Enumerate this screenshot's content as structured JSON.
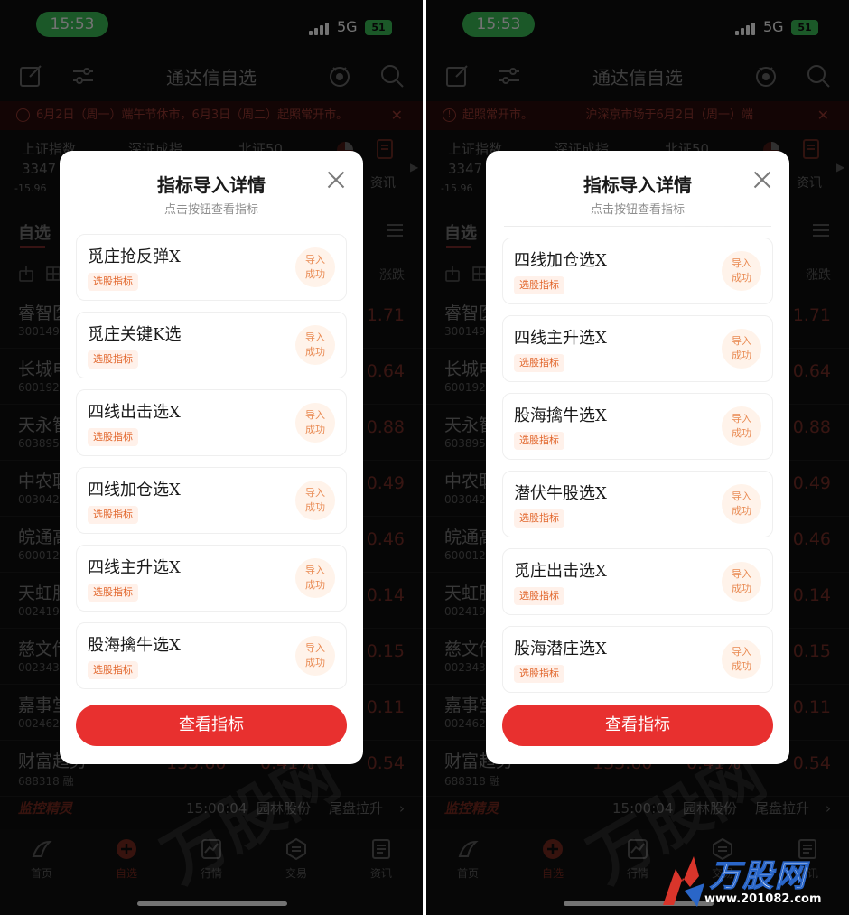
{
  "phones": [
    {
      "status": {
        "time": "15:53",
        "network": "5G",
        "battery": "51"
      },
      "nav": {
        "title": "通达信自选"
      },
      "ticker": {
        "text": "6月2日（周一）端午节休市，6月3日（周二）起照常开市。"
      },
      "indices": [
        {
          "name": "上证指数",
          "value": "3347",
          "change": "-15.96"
        },
        {
          "name": "深证成指"
        },
        {
          "name": "北证50"
        }
      ],
      "news_label": "资讯",
      "tab_zixuan": "自选",
      "col_header": "涨跌",
      "stocks": [
        {
          "name": "睿智医",
          "code": "300149",
          "chg": "1.71"
        },
        {
          "name": "长城电",
          "code": "600192",
          "chg": "0.64"
        },
        {
          "name": "天永智",
          "code": "603895",
          "chg": "0.88"
        },
        {
          "name": "中农联",
          "code": "003042",
          "chg": "0.49"
        },
        {
          "name": "皖通高",
          "code": "600012",
          "chg": "0.46"
        },
        {
          "name": "天虹股",
          "code": "002419",
          "chg": "0.14"
        },
        {
          "name": "慈文传",
          "code": "002343",
          "chg": "0.15"
        },
        {
          "name": "嘉事堂",
          "code": "002462",
          "chg": "0.11"
        },
        {
          "name": "财富趋势",
          "code": "688318 融",
          "price": "133.60",
          "pct": "0.41%",
          "chg": "0.54"
        }
      ],
      "monitor": {
        "logo": "监控精灵",
        "time": "15:00:04",
        "stock": "园林股份",
        "event": "尾盘拉升"
      },
      "tabbar": [
        "首页",
        "自选",
        "行情",
        "交易",
        "资讯"
      ],
      "modal": {
        "title": "指标导入详情",
        "subtitle": "点击按钮查看指标",
        "items": [
          {
            "name": "觅庄抢反弹X",
            "tag": "选股指标",
            "status_line1": "导入",
            "status_line2": "成功"
          },
          {
            "name": "觅庄关键K选",
            "tag": "选股指标",
            "status_line1": "导入",
            "status_line2": "成功"
          },
          {
            "name": "四线出击选X",
            "tag": "选股指标",
            "status_line1": "导入",
            "status_line2": "成功"
          },
          {
            "name": "四线加仓选X",
            "tag": "选股指标",
            "status_line1": "导入",
            "status_line2": "成功"
          },
          {
            "name": "四线主升选X",
            "tag": "选股指标",
            "status_line1": "导入",
            "status_line2": "成功"
          },
          {
            "name": "股海擒牛选X",
            "tag": "选股指标",
            "status_line1": "导入",
            "status_line2": "成功"
          }
        ],
        "button": "查看指标"
      }
    },
    {
      "status": {
        "time": "15:53",
        "network": "5G",
        "battery": "51"
      },
      "nav": {
        "title": "通达信自选"
      },
      "ticker": {
        "text": "起照常开市。　　　　　沪深京市场于6月2日（周一）端"
      },
      "indices": [
        {
          "name": "上证指数",
          "value": "3347",
          "change": "-15.96"
        },
        {
          "name": "深证成指"
        },
        {
          "name": "北证50"
        }
      ],
      "news_label": "资讯",
      "tab_zixuan": "自选",
      "col_header": "涨跌",
      "stocks": [
        {
          "name": "睿智医",
          "code": "300149",
          "chg": "1.71"
        },
        {
          "name": "长城电",
          "code": "600192",
          "chg": "0.64"
        },
        {
          "name": "天永智",
          "code": "603895",
          "chg": "0.88"
        },
        {
          "name": "中农联",
          "code": "003042",
          "chg": "0.49"
        },
        {
          "name": "皖通高",
          "code": "600012",
          "chg": "0.46"
        },
        {
          "name": "天虹股",
          "code": "002419",
          "chg": "0.14"
        },
        {
          "name": "慈文传",
          "code": "002343",
          "chg": "0.15"
        },
        {
          "name": "嘉事堂",
          "code": "002462",
          "chg": "0.11"
        },
        {
          "name": "财富趋势",
          "code": "688318 融",
          "price": "133.60",
          "pct": "0.41%",
          "chg": "0.54"
        }
      ],
      "monitor": {
        "logo": "监控精灵",
        "time": "15:00:04",
        "stock": "园林股份",
        "event": "尾盘拉升"
      },
      "tabbar": [
        "首页",
        "自选",
        "行情",
        "交易",
        "资讯"
      ],
      "modal": {
        "title": "指标导入详情",
        "subtitle": "点击按钮查看指标",
        "items": [
          {
            "name": "四线加仓选X",
            "tag": "选股指标",
            "status_line1": "导入",
            "status_line2": "成功"
          },
          {
            "name": "四线主升选X",
            "tag": "选股指标",
            "status_line1": "导入",
            "status_line2": "成功"
          },
          {
            "name": "股海擒牛选X",
            "tag": "选股指标",
            "status_line1": "导入",
            "status_line2": "成功"
          },
          {
            "name": "潜伏牛股选X",
            "tag": "选股指标",
            "status_line1": "导入",
            "status_line2": "成功"
          },
          {
            "name": "觅庄出击选X",
            "tag": "选股指标",
            "status_line1": "导入",
            "status_line2": "成功"
          },
          {
            "name": "股海潜庄选X",
            "tag": "选股指标",
            "status_line1": "导入",
            "status_line2": "成功"
          }
        ],
        "button": "查看指标"
      }
    }
  ],
  "watermark": {
    "brand": "万股网",
    "url": "www.201082.com"
  },
  "corner_logo": {
    "name": "万股网",
    "url": "www.201082.com"
  }
}
